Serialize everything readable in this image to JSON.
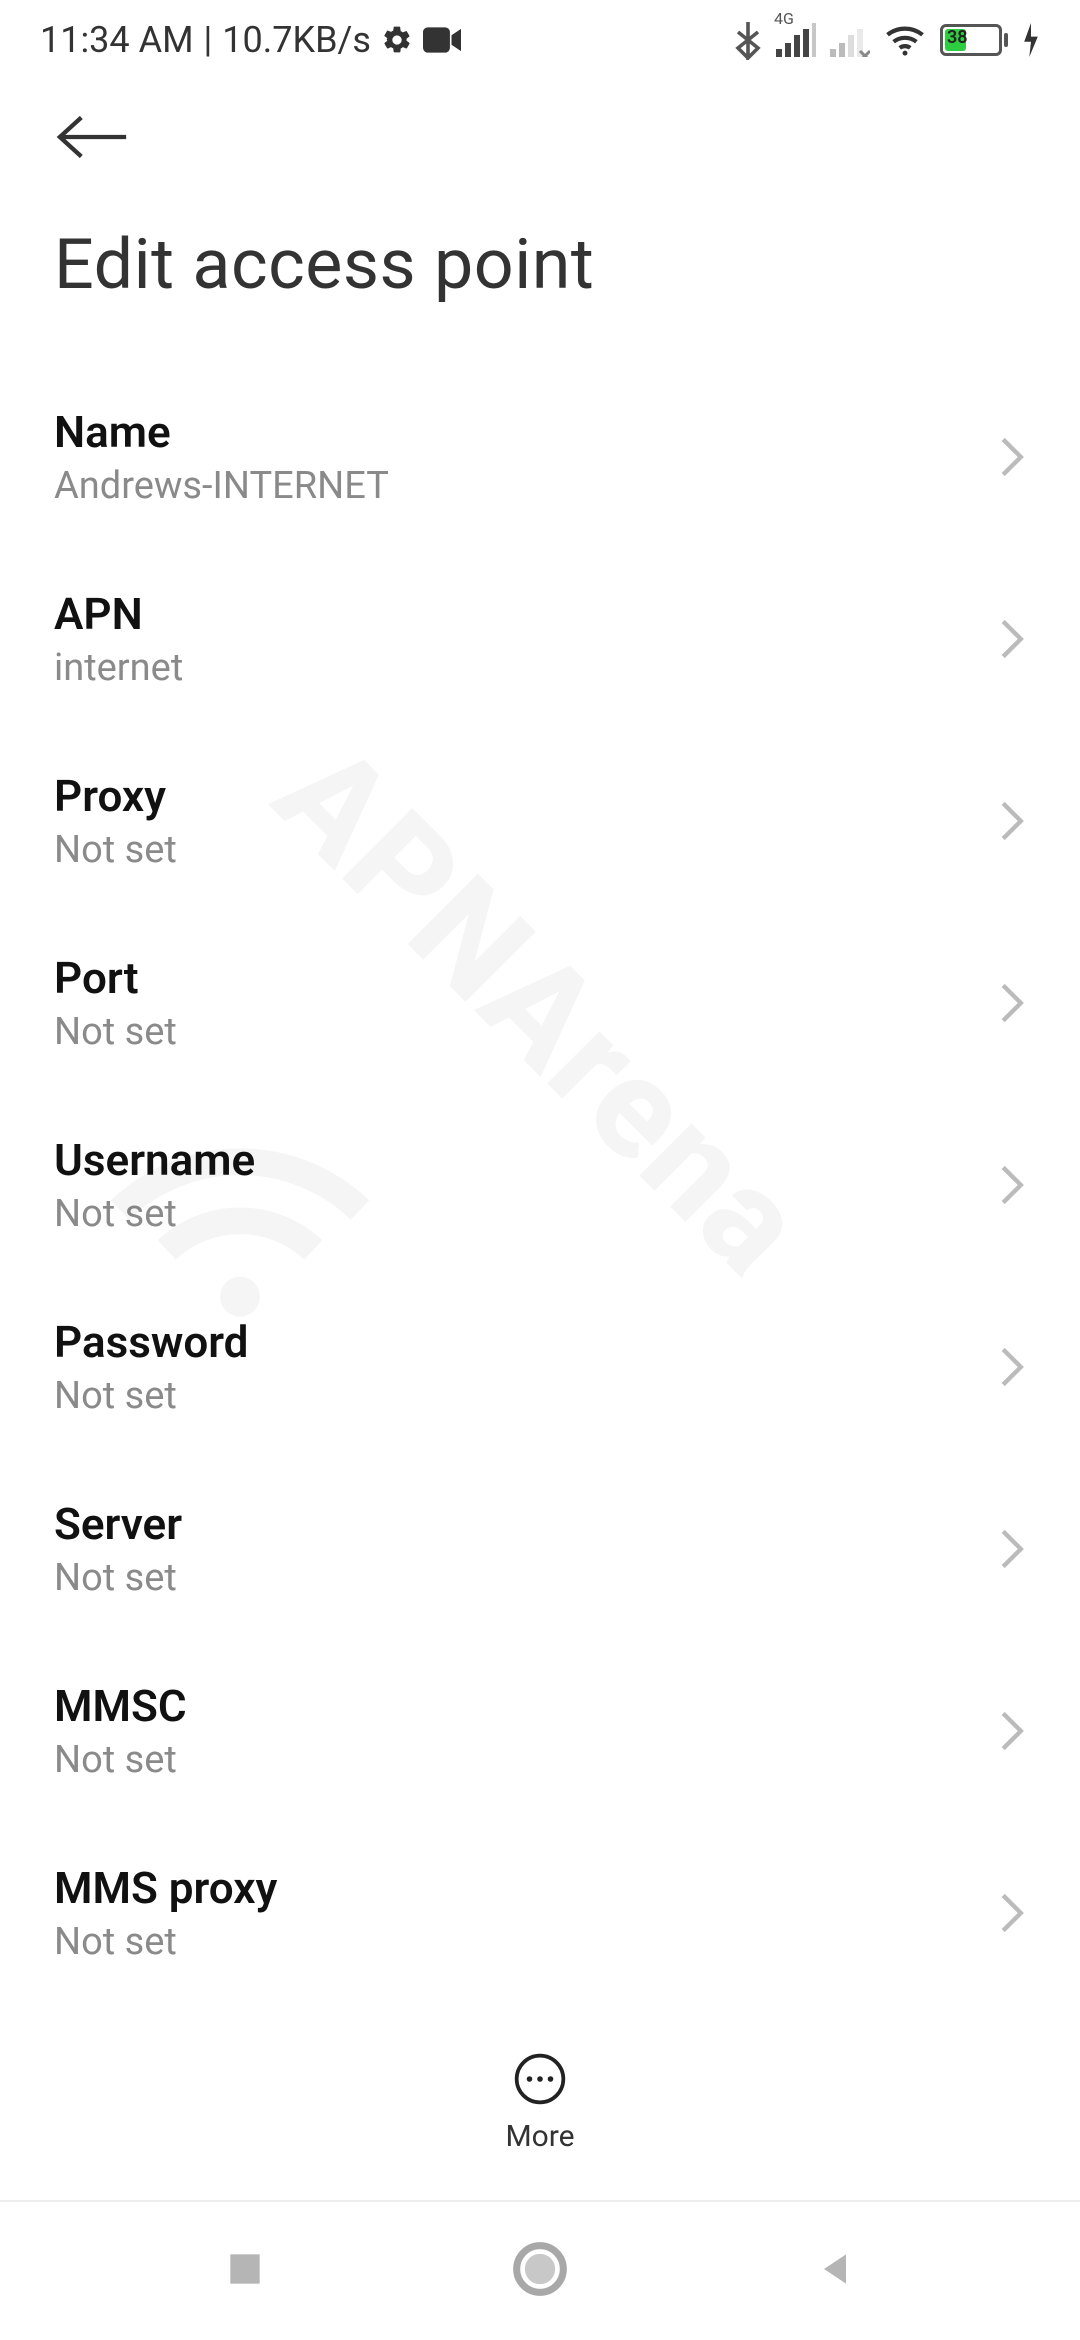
{
  "status": {
    "time": "11:34 AM",
    "speed": "10.7KB/s",
    "network_label": "4G",
    "battery_percent": "38"
  },
  "header": {
    "title": "Edit access point"
  },
  "items": [
    {
      "label": "Name",
      "value": "Andrews-INTERNET"
    },
    {
      "label": "APN",
      "value": "internet"
    },
    {
      "label": "Proxy",
      "value": "Not set"
    },
    {
      "label": "Port",
      "value": "Not set"
    },
    {
      "label": "Username",
      "value": "Not set"
    },
    {
      "label": "Password",
      "value": "Not set"
    },
    {
      "label": "Server",
      "value": "Not set"
    },
    {
      "label": "MMSC",
      "value": "Not set"
    },
    {
      "label": "MMS proxy",
      "value": "Not set"
    }
  ],
  "action": {
    "more_label": "More"
  },
  "watermark": "APNArena"
}
